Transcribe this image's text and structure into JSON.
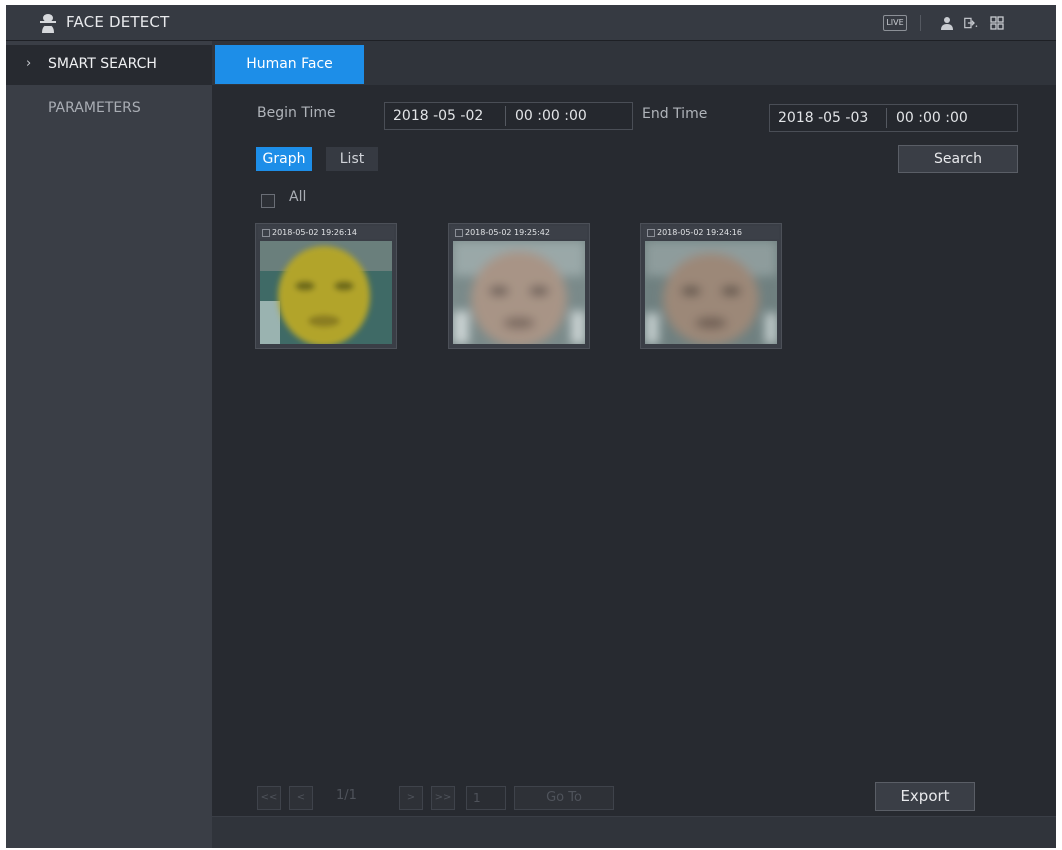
{
  "app": {
    "title": "FACE DETECT"
  },
  "topbar": {
    "live_label": "LIVE"
  },
  "sidebar": {
    "items": [
      {
        "label": "SMART SEARCH",
        "chevron": "›"
      },
      {
        "label": "PARAMETERS"
      }
    ]
  },
  "tabs": [
    {
      "label": "Human Face"
    }
  ],
  "filters": {
    "begin_label": "Begin Time",
    "begin_date": "2018 -05 -02",
    "begin_time": "00 :00 :00",
    "end_label": "End Time",
    "end_date": "2018 -05 -03",
    "end_time": "00 :00 :00"
  },
  "view": {
    "graph_label": "Graph",
    "list_label": "List"
  },
  "search_label": "Search",
  "select_all_label": "All",
  "results": [
    {
      "timestamp": "2018-05-02 19:26:14"
    },
    {
      "timestamp": "2018-05-02 19:25:42"
    },
    {
      "timestamp": "2018-05-02 19:24:16"
    }
  ],
  "pager": {
    "first": "<<",
    "prev": "<",
    "page_info": "1/1",
    "next": ">",
    "last": ">>",
    "page_input": "1",
    "goto_label": "Go To"
  },
  "export_label": "Export",
  "colors": {
    "accent": "#1d8ee8",
    "background": "#272a30",
    "sidebar": "#3a3e46"
  },
  "icons": [
    "face-detect-icon",
    "user-icon",
    "logout-icon",
    "menu-icon",
    "chevron-right-icon"
  ]
}
